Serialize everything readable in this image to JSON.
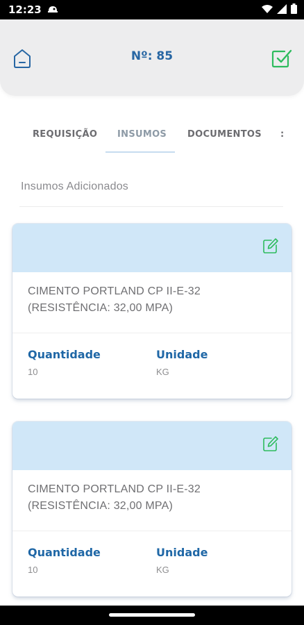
{
  "status_bar": {
    "time": "12:23",
    "icons": [
      "notification-icon",
      "wifi-icon",
      "signal-icon",
      "battery-icon"
    ]
  },
  "header": {
    "title": "Nº: 85",
    "left_icon": "home-icon",
    "right_icon": "checkbox-confirm-icon"
  },
  "tabs": [
    {
      "label": "REQUISIÇÃO",
      "active": false
    },
    {
      "label": "INSUMOS",
      "active": true
    },
    {
      "label": "DOCUMENTOS",
      "active": false
    }
  ],
  "section": {
    "title": "Insumos Adicionados"
  },
  "items": [
    {
      "description": "CIMENTO PORTLAND CP II-E-32 (RESISTÊNCIA: 32,00 MPA)",
      "quantity_label": "Quantidade",
      "quantity": "10",
      "unit_label": "Unidade",
      "unit": "KG"
    },
    {
      "description": "CIMENTO PORTLAND CP II-E-32 (RESISTÊNCIA: 32,00 MPA)",
      "quantity_label": "Quantidade",
      "quantity": "10",
      "unit_label": "Unidade",
      "unit": "KG"
    }
  ],
  "colors": {
    "accent_blue": "#1f67a6",
    "confirm_green": "#2dbb5d",
    "card_header": "#d0e7f8"
  }
}
